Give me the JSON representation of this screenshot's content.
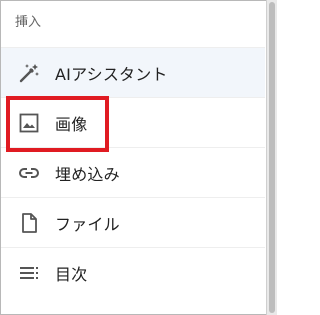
{
  "header": {
    "title": "挿入"
  },
  "menu": {
    "items": [
      {
        "label": "AIアシスタント",
        "icon": "magic-wand-icon"
      },
      {
        "label": "画像",
        "icon": "image-icon"
      },
      {
        "label": "埋め込み",
        "icon": "link-icon"
      },
      {
        "label": "ファイル",
        "icon": "file-icon"
      },
      {
        "label": "目次",
        "icon": "toc-icon"
      }
    ]
  },
  "colors": {
    "highlight": "#e01b22",
    "icon": "#555555",
    "hover_bg": "#f2f6fb"
  }
}
